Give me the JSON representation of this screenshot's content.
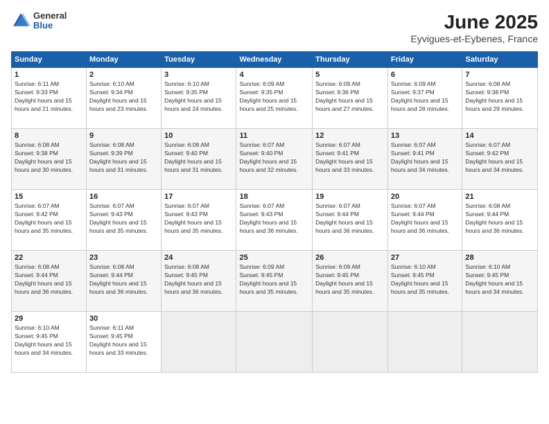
{
  "header": {
    "logo": {
      "general": "General",
      "blue": "Blue"
    },
    "title": "June 2025",
    "location": "Eyvigues-et-Eybenes, France"
  },
  "weekdays": [
    "Sunday",
    "Monday",
    "Tuesday",
    "Wednesday",
    "Thursday",
    "Friday",
    "Saturday"
  ],
  "weeks": [
    [
      {
        "day": "1",
        "sunrise": "6:11 AM",
        "sunset": "9:33 PM",
        "daylight": "15 hours and 21 minutes."
      },
      {
        "day": "2",
        "sunrise": "6:10 AM",
        "sunset": "9:34 PM",
        "daylight": "15 hours and 23 minutes."
      },
      {
        "day": "3",
        "sunrise": "6:10 AM",
        "sunset": "9:35 PM",
        "daylight": "15 hours and 24 minutes."
      },
      {
        "day": "4",
        "sunrise": "6:09 AM",
        "sunset": "9:35 PM",
        "daylight": "15 hours and 25 minutes."
      },
      {
        "day": "5",
        "sunrise": "6:09 AM",
        "sunset": "9:36 PM",
        "daylight": "15 hours and 27 minutes."
      },
      {
        "day": "6",
        "sunrise": "6:09 AM",
        "sunset": "9:37 PM",
        "daylight": "15 hours and 28 minutes."
      },
      {
        "day": "7",
        "sunrise": "6:08 AM",
        "sunset": "9:38 PM",
        "daylight": "15 hours and 29 minutes."
      }
    ],
    [
      {
        "day": "8",
        "sunrise": "6:08 AM",
        "sunset": "9:38 PM",
        "daylight": "15 hours and 30 minutes."
      },
      {
        "day": "9",
        "sunrise": "6:08 AM",
        "sunset": "9:39 PM",
        "daylight": "15 hours and 31 minutes."
      },
      {
        "day": "10",
        "sunrise": "6:08 AM",
        "sunset": "9:40 PM",
        "daylight": "15 hours and 31 minutes."
      },
      {
        "day": "11",
        "sunrise": "6:07 AM",
        "sunset": "9:40 PM",
        "daylight": "15 hours and 32 minutes."
      },
      {
        "day": "12",
        "sunrise": "6:07 AM",
        "sunset": "9:41 PM",
        "daylight": "15 hours and 33 minutes."
      },
      {
        "day": "13",
        "sunrise": "6:07 AM",
        "sunset": "9:41 PM",
        "daylight": "15 hours and 34 minutes."
      },
      {
        "day": "14",
        "sunrise": "6:07 AM",
        "sunset": "9:42 PM",
        "daylight": "15 hours and 34 minutes."
      }
    ],
    [
      {
        "day": "15",
        "sunrise": "6:07 AM",
        "sunset": "9:42 PM",
        "daylight": "15 hours and 35 minutes."
      },
      {
        "day": "16",
        "sunrise": "6:07 AM",
        "sunset": "9:43 PM",
        "daylight": "15 hours and 35 minutes."
      },
      {
        "day": "17",
        "sunrise": "6:07 AM",
        "sunset": "9:43 PM",
        "daylight": "15 hours and 35 minutes."
      },
      {
        "day": "18",
        "sunrise": "6:07 AM",
        "sunset": "9:43 PM",
        "daylight": "15 hours and 36 minutes."
      },
      {
        "day": "19",
        "sunrise": "6:07 AM",
        "sunset": "9:44 PM",
        "daylight": "15 hours and 36 minutes."
      },
      {
        "day": "20",
        "sunrise": "6:07 AM",
        "sunset": "9:44 PM",
        "daylight": "15 hours and 36 minutes."
      },
      {
        "day": "21",
        "sunrise": "6:08 AM",
        "sunset": "9:44 PM",
        "daylight": "15 hours and 36 minutes."
      }
    ],
    [
      {
        "day": "22",
        "sunrise": "6:08 AM",
        "sunset": "9:44 PM",
        "daylight": "15 hours and 36 minutes."
      },
      {
        "day": "23",
        "sunrise": "6:08 AM",
        "sunset": "9:44 PM",
        "daylight": "15 hours and 36 minutes."
      },
      {
        "day": "24",
        "sunrise": "6:08 AM",
        "sunset": "9:45 PM",
        "daylight": "15 hours and 36 minutes."
      },
      {
        "day": "25",
        "sunrise": "6:09 AM",
        "sunset": "9:45 PM",
        "daylight": "15 hours and 35 minutes."
      },
      {
        "day": "26",
        "sunrise": "6:09 AM",
        "sunset": "9:45 PM",
        "daylight": "15 hours and 35 minutes."
      },
      {
        "day": "27",
        "sunrise": "6:10 AM",
        "sunset": "9:45 PM",
        "daylight": "15 hours and 35 minutes."
      },
      {
        "day": "28",
        "sunrise": "6:10 AM",
        "sunset": "9:45 PM",
        "daylight": "15 hours and 34 minutes."
      }
    ],
    [
      {
        "day": "29",
        "sunrise": "6:10 AM",
        "sunset": "9:45 PM",
        "daylight": "15 hours and 34 minutes."
      },
      {
        "day": "30",
        "sunrise": "6:11 AM",
        "sunset": "9:45 PM",
        "daylight": "15 hours and 33 minutes."
      },
      null,
      null,
      null,
      null,
      null
    ]
  ]
}
